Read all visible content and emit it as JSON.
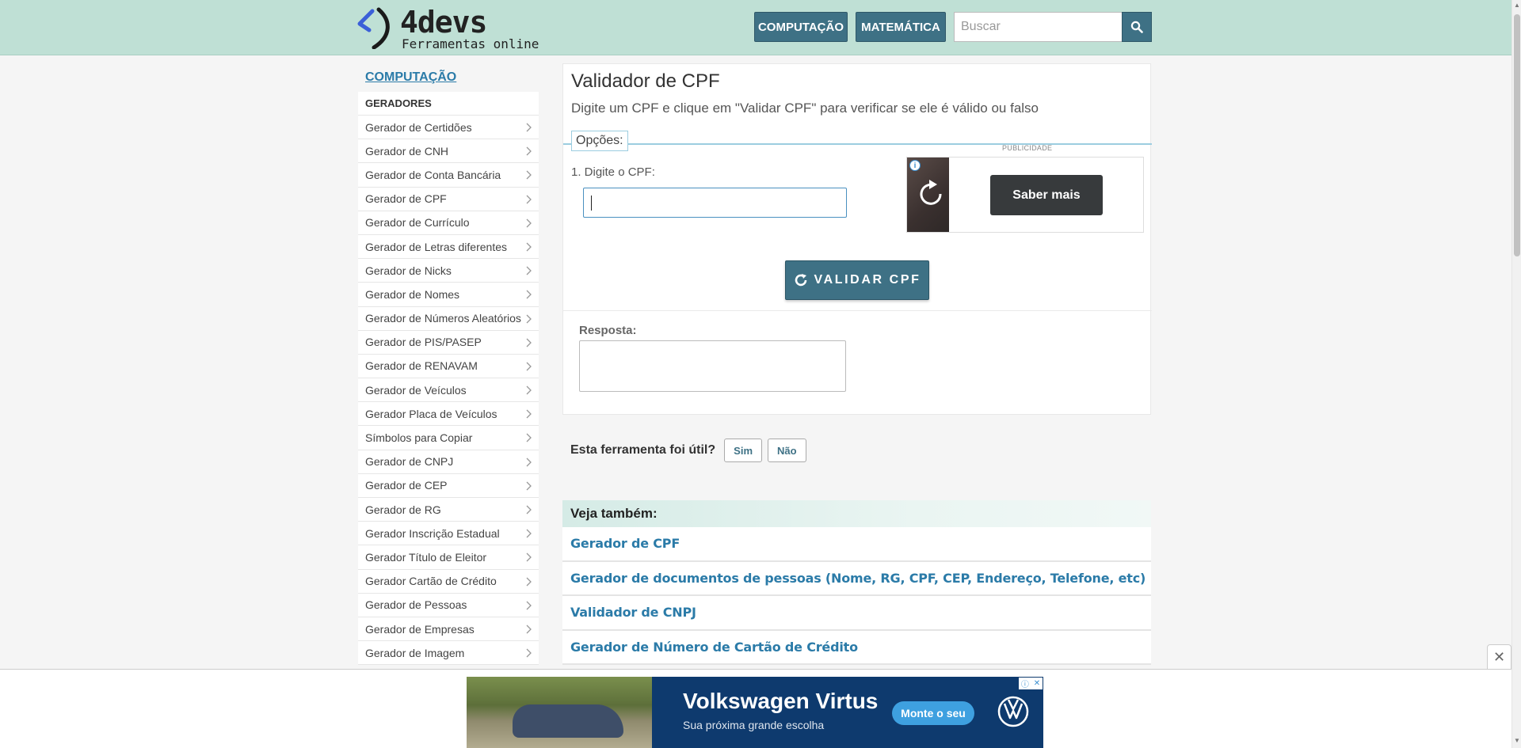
{
  "header": {
    "logo": {
      "name": "4devs",
      "tagline": "Ferramentas online"
    },
    "nav": [
      {
        "label": "COMPUTAÇÃO"
      },
      {
        "label": "MATEMÁTICA"
      }
    ],
    "search": {
      "placeholder": "Buscar",
      "icon": "search-icon"
    }
  },
  "sidebar": {
    "title": "COMPUTAÇÃO",
    "section": "GERADORES",
    "items": [
      "Gerador de Certidões",
      "Gerador de CNH",
      "Gerador de Conta Bancária",
      "Gerador de CPF",
      "Gerador de Currículo",
      "Gerador de Letras diferentes",
      "Gerador de Nicks",
      "Gerador de Nomes",
      "Gerador de Números Aleatórios",
      "Gerador de PIS/PASEP",
      "Gerador de RENAVAM",
      "Gerador de Veículos",
      "Gerador Placa de Veículos",
      "Símbolos para Copiar",
      "Gerador de CNPJ",
      "Gerador de CEP",
      "Gerador de RG",
      "Gerador Inscrição Estadual",
      "Gerador Título de Eleitor",
      "Gerador Cartão de Crédito",
      "Gerador de Pessoas",
      "Gerador de Empresas",
      "Gerador de Imagem"
    ]
  },
  "main": {
    "title": "Validador de CPF",
    "subtitle": "Digite um CPF e clique em \"Validar CPF\" para verificar se ele é válido ou falso",
    "options_legend": "Opções:",
    "cpf_label": "1. Digite o CPF:",
    "cpf_value": "",
    "validate_button": "VALIDAR CPF",
    "answer_label": "Resposta:",
    "answer_value": "",
    "ad": {
      "label": "PUBLICIDADE",
      "button": "Saber mais"
    }
  },
  "feedback": {
    "question": "Esta ferramenta foi útil?",
    "yes": "Sim",
    "no": "Não"
  },
  "see_also": {
    "heading": "Veja também:",
    "links": [
      "Gerador de CPF",
      "Gerador de documentos de pessoas (Nome, RG, CPF, CEP, Endereço, Telefone, etc)",
      "Validador de CNPJ",
      "Gerador de Número de Cartão de Crédito"
    ]
  },
  "bottom_ad": {
    "title": "Volkswagen Virtus",
    "subtitle": "Sua próxima grande escolha",
    "cta": "Monte o seu",
    "close": "✕"
  },
  "colors": {
    "header_bg": "#bfe0d5",
    "primary": "#3e7185",
    "link": "#2b7ba8",
    "ad_bg": "#0e3a6e"
  }
}
